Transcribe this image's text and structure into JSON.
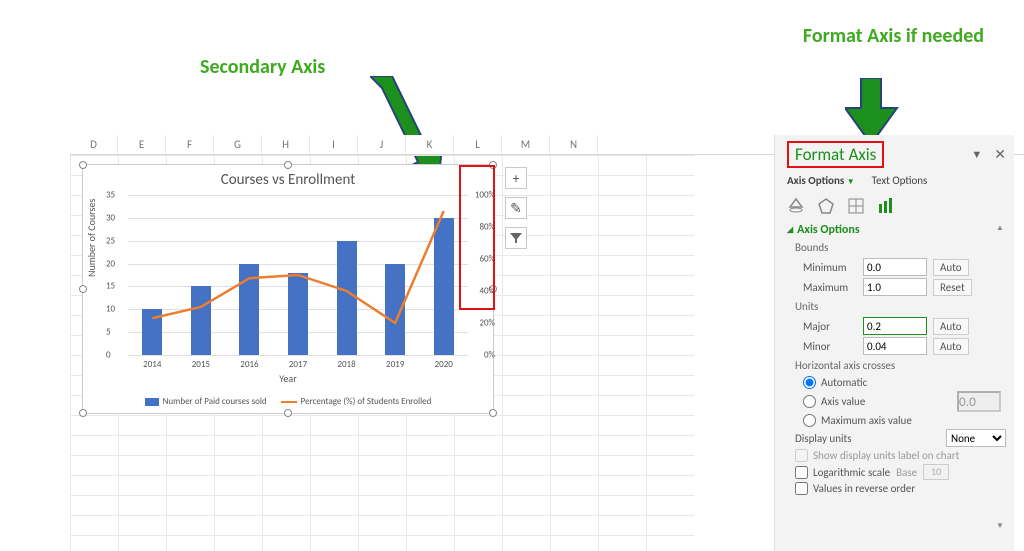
{
  "annotations": {
    "secondary_axis": "Secondary Axis",
    "format_axis_if_needed": "Format Axis if needed"
  },
  "columns": [
    "D",
    "E",
    "F",
    "G",
    "H",
    "I",
    "J",
    "K",
    "L",
    "M",
    "N"
  ],
  "chart_data": {
    "type": "bar+line",
    "title": "Courses vs Enrollment",
    "xlabel": "Year",
    "ylabel": "Number of Courses",
    "categories": [
      "2014",
      "2015",
      "2016",
      "2017",
      "2018",
      "2019",
      "2020"
    ],
    "series": [
      {
        "name": "Number of Paid courses sold",
        "type": "bar",
        "values": [
          10,
          15,
          20,
          18,
          25,
          20,
          30
        ],
        "axis": "primary"
      },
      {
        "name": "Percentage (%) of Students Enrolled",
        "type": "line",
        "values": [
          0.23,
          0.3,
          0.48,
          0.5,
          0.4,
          0.2,
          0.9
        ],
        "axis": "secondary"
      }
    ],
    "y_primary": {
      "min": 0,
      "max": 35,
      "major": 5,
      "ticks": [
        "0",
        "5",
        "10",
        "15",
        "20",
        "25",
        "30",
        "35"
      ]
    },
    "y_secondary": {
      "min": 0,
      "max": 1.0,
      "major": 0.2,
      "ticks": [
        "0%",
        "20%",
        "40%",
        "60%",
        "80%",
        "100%"
      ]
    }
  },
  "chart_icons": {
    "add": "+",
    "brush": "✎",
    "filter": "▾"
  },
  "pane": {
    "title": "Format Axis",
    "tabs": {
      "axis_options": "Axis Options",
      "text_options": "Text Options"
    },
    "section": "Axis Options",
    "groups": {
      "bounds": "Bounds",
      "units": "Units",
      "hcrosses": "Horizontal axis crosses",
      "display_units": "Display units"
    },
    "fields": {
      "minimum_label": "Minimum",
      "minimum_val": "0.0",
      "minimum_btn": "Auto",
      "maximum_label": "Maximum",
      "maximum_val": "1.0",
      "maximum_btn": "Reset",
      "major_label": "Major",
      "major_val": "0.2",
      "major_btn": "Auto",
      "minor_label": "Minor",
      "minor_val": "0.04",
      "minor_btn": "Auto",
      "automatic": "Automatic",
      "axis_value": "Axis value",
      "axis_value_val": "0.0",
      "max_axis_value": "Maximum axis value",
      "display_units_val": "None",
      "show_label": "Show display units label on chart",
      "log_scale": "Logarithmic scale",
      "base_label": "Base",
      "base_val": "10",
      "reverse": "Values in reverse order"
    }
  }
}
